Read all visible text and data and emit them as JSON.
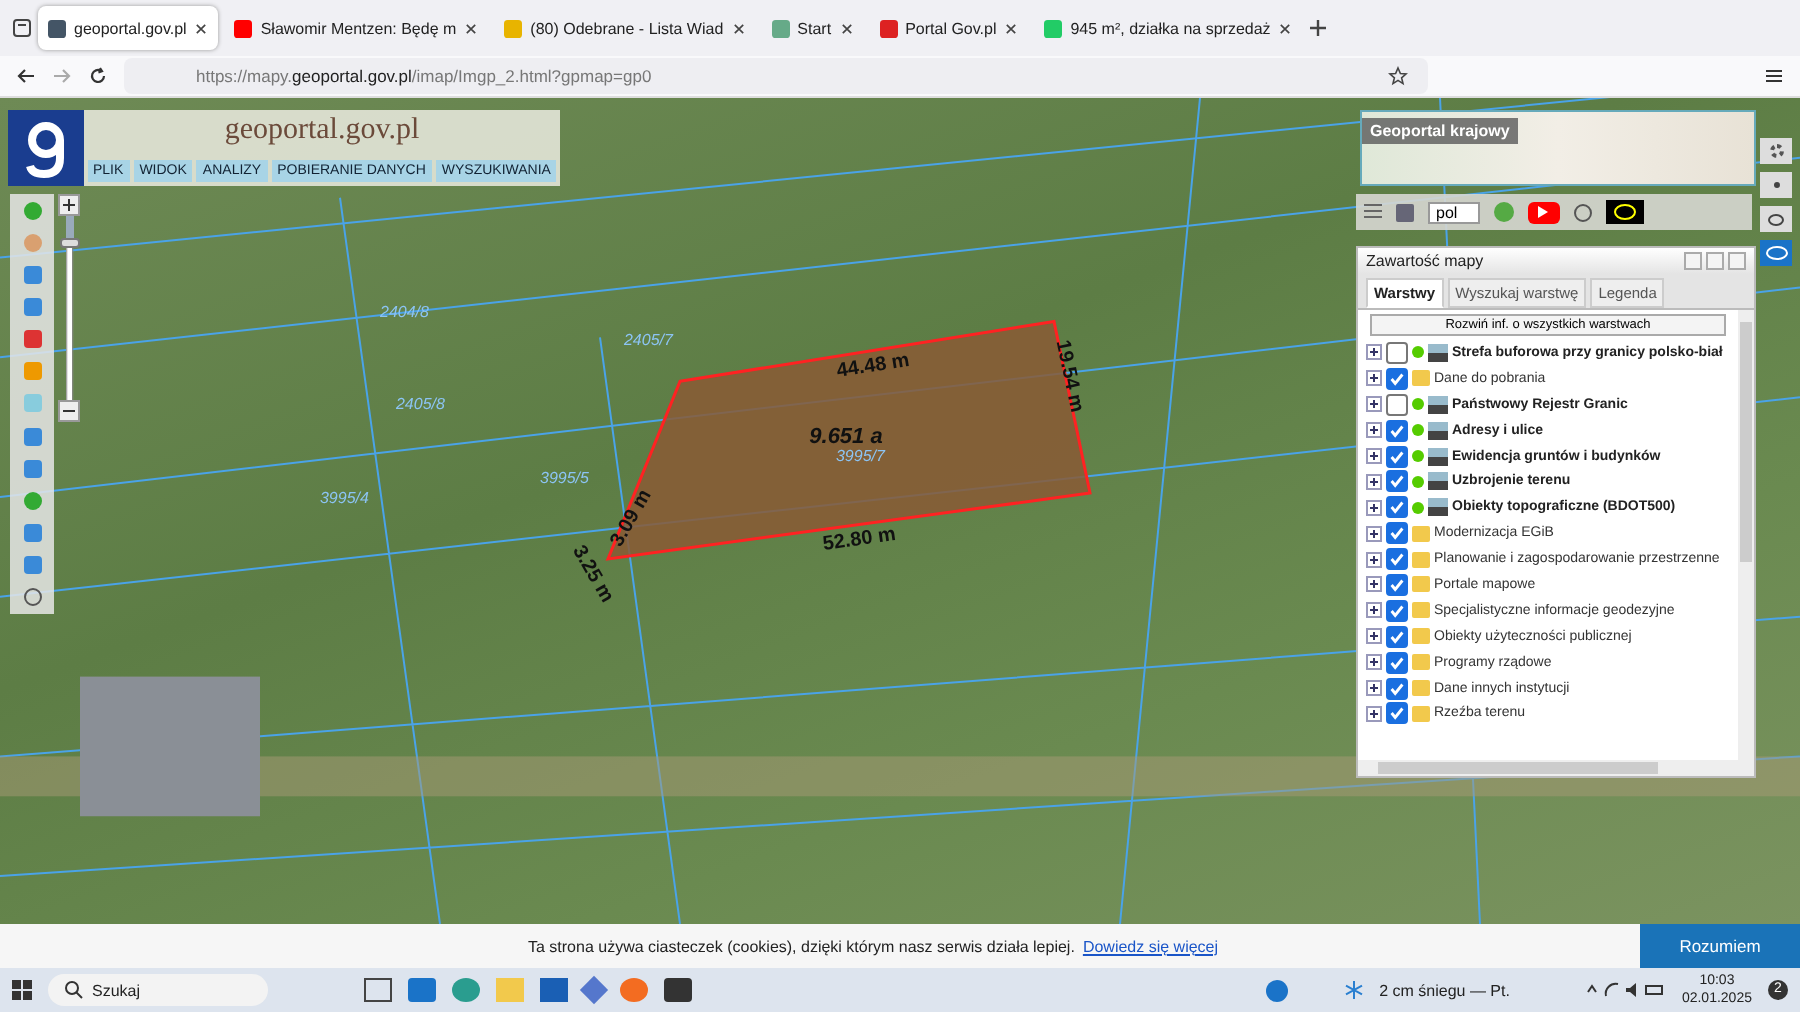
{
  "browser": {
    "tabs": [
      {
        "title": "geoportal.gov.pl",
        "selected": true
      },
      {
        "title": "Sławomir Mentzen: Będę m",
        "selected": false
      },
      {
        "title": "(80) Odebrane - Lista Wiad",
        "selected": false
      },
      {
        "title": "Start",
        "selected": false
      },
      {
        "title": "Portal Gov.pl",
        "selected": false
      },
      {
        "title": "945 m², działka na sprzedaż",
        "selected": false
      }
    ],
    "url_prefix": "https://mapy.",
    "url_domain": "geoportal.gov.pl",
    "url_rest": "/imap/Imgp_2.html?gpmap=gp0"
  },
  "geoportal": {
    "logo": "geoportal.gov.pl",
    "menu": [
      "PLIK",
      "WIDOK",
      "ANALIZY",
      "POBIERANIE DANYCH",
      "WYSZUKIWANIA"
    ],
    "minimap_title": "Geoportal krajowy",
    "language": "pol",
    "zoom": {
      "level": 0.12
    }
  },
  "map": {
    "parcels": [
      "2404/8",
      "2405/8",
      "2405/7",
      "3995/4",
      "3995/5",
      "3995/7"
    ],
    "measurements": {
      "top": "44.48 m",
      "right": "19.54 m",
      "bottom": "52.80 m",
      "left": "3.09 m",
      "corner": "3.25 m",
      "area": "9.651 a"
    }
  },
  "layer_panel": {
    "title": "Zawartość mapy",
    "tabs": [
      {
        "label": "Warstwy",
        "selected": true
      },
      {
        "label": "Wyszukaj warstwę",
        "selected": false
      },
      {
        "label": "Legenda",
        "selected": false
      }
    ],
    "expand_button": "Rozwiń inf. o wszystkich warstwach",
    "layers": [
      {
        "name": "Strefa buforowa przy granicy polsko-biał",
        "kind": "service",
        "checked": false
      },
      {
        "name": "Dane do pobrania",
        "kind": "folder",
        "checked": true
      },
      {
        "name": "Państwowy Rejestr Granic",
        "kind": "service",
        "checked": false
      },
      {
        "name": "Adresy i ulice",
        "kind": "service",
        "checked": true
      },
      {
        "name": "Ewidencja gruntów i budynków",
        "kind": "service",
        "checked": true
      },
      {
        "name": "Uzbrojenie terenu",
        "kind": "service",
        "checked": true
      },
      {
        "name": "Obiekty topograficzne (BDOT500)",
        "kind": "service",
        "checked": true
      },
      {
        "name": "Modernizacja EGiB",
        "kind": "folder",
        "checked": true
      },
      {
        "name": "Planowanie i zagospodarowanie przestrzenne",
        "kind": "folder",
        "checked": true
      },
      {
        "name": "Portale mapowe",
        "kind": "folder",
        "checked": true
      },
      {
        "name": "Specjalistyczne informacje geodezyjne",
        "kind": "folder",
        "checked": true
      },
      {
        "name": "Obiekty użyteczności publicznej",
        "kind": "folder",
        "checked": true
      },
      {
        "name": "Programy rządowe",
        "kind": "folder",
        "checked": true
      },
      {
        "name": "Dane innych instytucji",
        "kind": "folder",
        "checked": true
      },
      {
        "name": "Rzeźba terenu",
        "kind": "folder",
        "checked": true
      }
    ]
  },
  "cookie_bar": {
    "text": "Ta strona używa ciasteczek (cookies), dzięki którym nasz serwis działa lepiej.",
    "link": "Dowiedz się więcej",
    "button": "Rozumiem"
  },
  "taskbar": {
    "search": "Szukaj",
    "weather": "2 cm śniegu — Pt.",
    "time": "10:03",
    "date": "02.01.2025",
    "notifications": "2"
  }
}
